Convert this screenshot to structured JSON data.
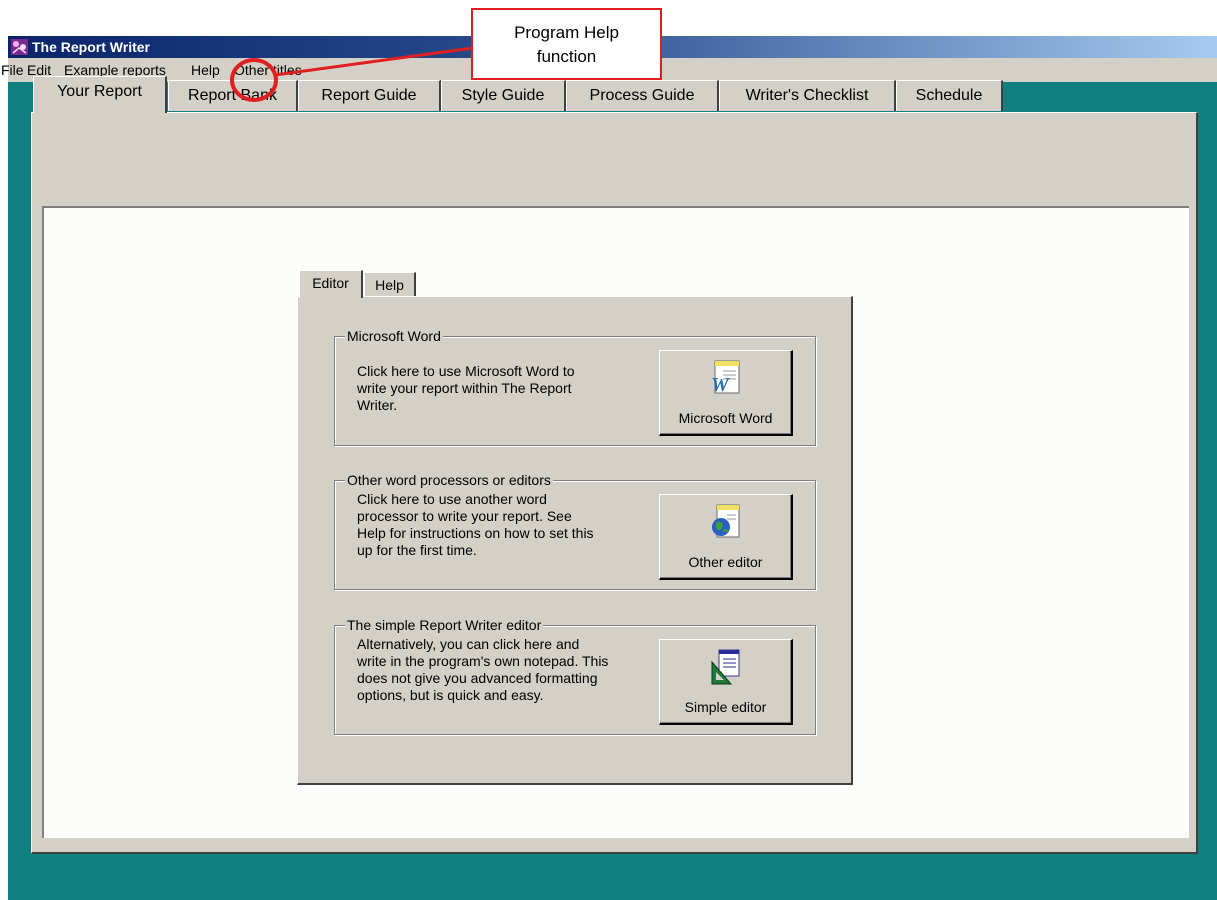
{
  "window": {
    "title": "The Report Writer"
  },
  "menu": [
    "File",
    "Edit",
    "Example reports",
    "Help",
    "Other titles"
  ],
  "tabs": [
    "Your Report",
    "Report Bank",
    "Report Guide",
    "Style Guide",
    "Process Guide",
    "Writer's Checklist",
    "Schedule"
  ],
  "active_tab": "Your Report",
  "inner_tabs": [
    "Editor",
    "Help"
  ],
  "active_inner_tab": "Editor",
  "groups": [
    {
      "title": "Microsoft Word",
      "text": [
        "Click here to use Microsoft Word to",
        "write your report within The Report",
        "Writer."
      ],
      "button_label": "Microsoft Word",
      "icon": "word-document-icon"
    },
    {
      "title": "Other word processors or editors",
      "text": [
        "Click here to use another word",
        "processor to write your report. See",
        "Help for instructions on how to set this",
        "up for the first time."
      ],
      "button_label": "Other editor",
      "icon": "globe-document-icon"
    },
    {
      "title": "The simple Report Writer editor",
      "text": [
        "Alternatively, you can click here and",
        "write in the program's own notepad. This",
        "does not give you advanced formatting",
        "options, but is quick and easy."
      ],
      "button_label": "Simple editor",
      "icon": "notepad-ruler-icon"
    }
  ],
  "annotation": {
    "text": [
      "Program Help",
      "function"
    ],
    "highlight_color": "#e02020"
  },
  "colors": {
    "desktop": "#0f7f7f",
    "face": "#d4d0c8",
    "title_start": "#0a246a",
    "title_end": "#a6caf0"
  }
}
